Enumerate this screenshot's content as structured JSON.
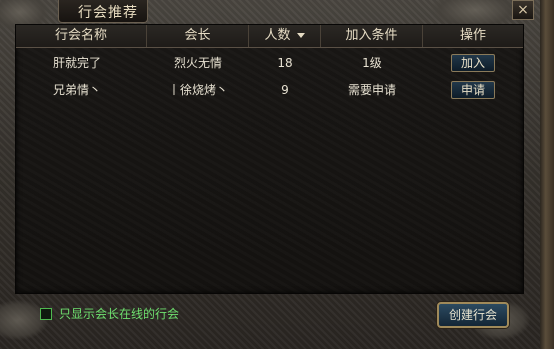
{
  "window": {
    "title": "行会推荐",
    "close_label": "×"
  },
  "table": {
    "columns": [
      "行会名称",
      "会长",
      "人数",
      "加入条件",
      "操作"
    ],
    "rows": [
      {
        "name": "肝就完了",
        "leader": "烈火无情",
        "members": "18",
        "condition": "1级",
        "action": "加入"
      },
      {
        "name": "兄弟情丶",
        "leader": "丨徐烧烤丶",
        "members": "9",
        "condition": "需要申请",
        "action": "申请"
      }
    ]
  },
  "footer": {
    "checkbox_label": "只显示会长在线的行会",
    "create_button": "创建行会"
  }
}
